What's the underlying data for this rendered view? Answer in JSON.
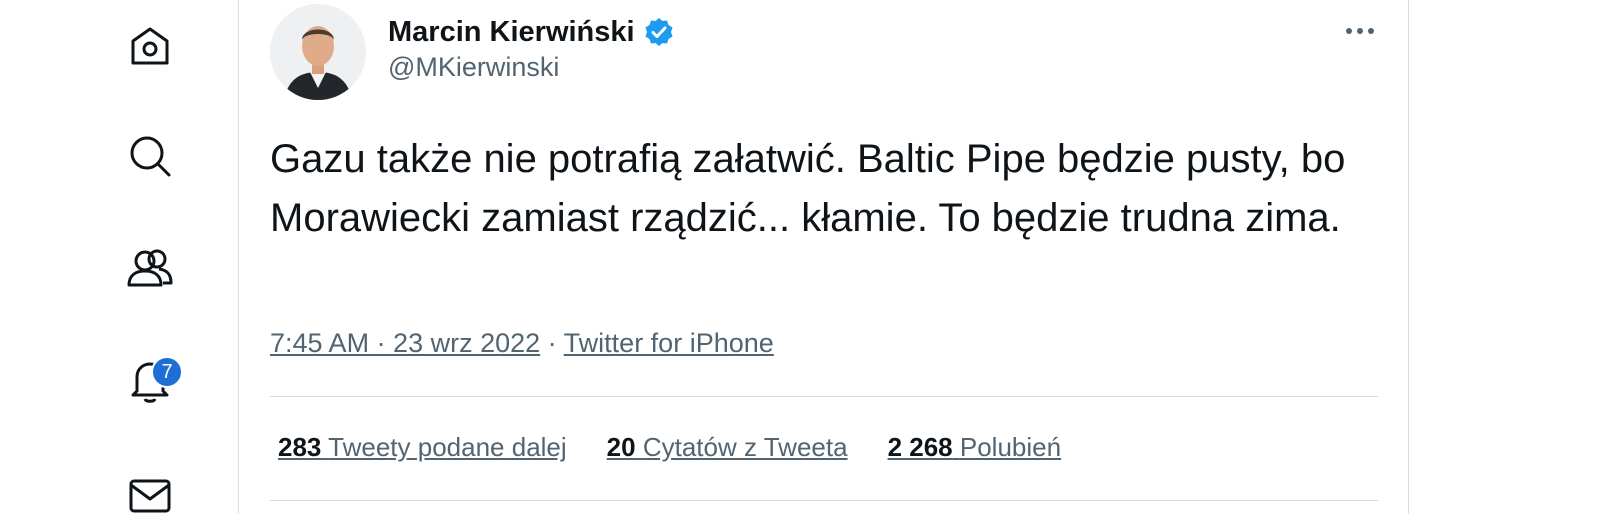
{
  "nav": {
    "items": [
      {
        "name": "home",
        "icon": "home-icon"
      },
      {
        "name": "explore",
        "icon": "search-icon"
      },
      {
        "name": "communities",
        "icon": "people-icon"
      },
      {
        "name": "notifications",
        "icon": "bell-icon",
        "badge": "7"
      },
      {
        "name": "messages",
        "icon": "mail-icon"
      }
    ],
    "badge_color": "#1d6fd6"
  },
  "tweet": {
    "author_name": "Marcin Kierwiński",
    "handle": "@MKierwinski",
    "verified": true,
    "text": "Gazu także nie potrafią załatwić. Baltic Pipe będzie pusty, bo Morawiecki zamiast rządzić... kłamie. To będzie trudna zima.",
    "timestamp": "7:45 AM · 23 wrz 2022",
    "separator": " · ",
    "source": "Twitter for iPhone",
    "more_icon": "more-icon",
    "stats": {
      "retweets_count": "283",
      "retweets_label": "Tweety podane dalej",
      "quotes_count": "20",
      "quotes_label": "Cytatów z Tweeta",
      "likes_count": "2 268",
      "likes_label": "Polubień"
    }
  },
  "colors": {
    "text_primary": "#0f1419",
    "text_secondary": "#536471",
    "verified_blue": "#1d9bf0"
  }
}
